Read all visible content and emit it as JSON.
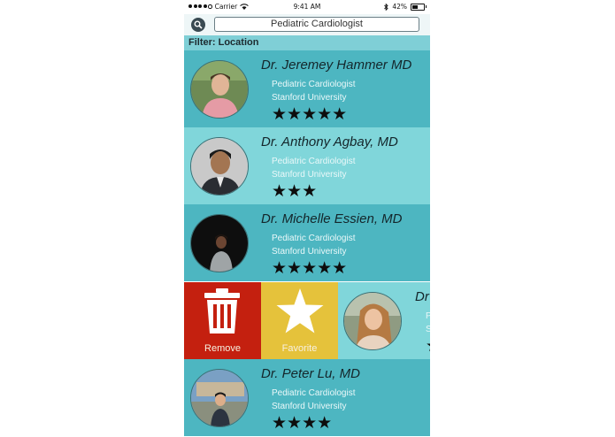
{
  "status_bar": {
    "carrier": "Carrier",
    "time": "9:41 AM",
    "battery": "42%",
    "icons": [
      "signal-dots-icon",
      "wifi-icon",
      "bluetooth-icon",
      "battery-icon"
    ]
  },
  "search": {
    "value": "Pediatric Cardiologist",
    "icon": "search-icon"
  },
  "filter": {
    "label": "Filter: Location"
  },
  "doctors": [
    {
      "name": "Dr. Jeremey Hammer MD",
      "specialty": "Pediatric Cardiologist",
      "institution": "Stanford University",
      "rating": 5,
      "stars": "★★★★★"
    },
    {
      "name": "Dr. Anthony Agbay, MD",
      "specialty": "Pediatric Cardiologist",
      "institution": "Stanford University",
      "rating": 3,
      "stars": "★★★"
    },
    {
      "name": "Dr. Michelle Essien, MD",
      "specialty": "Pediatric Cardiologist",
      "institution": "Stanford University",
      "rating": 5,
      "stars": "★★★★★"
    },
    {
      "name": "Dr",
      "specialty": "P",
      "institution": "S",
      "rating": 1,
      "stars": "★"
    },
    {
      "name": "Dr. Peter Lu, MD",
      "specialty": "Pediatric Cardiologist",
      "institution": "Stanford University",
      "rating": 4,
      "stars": "★★★★"
    }
  ],
  "swipe_actions": {
    "remove": "Remove",
    "favorite": "Favorite"
  },
  "colors": {
    "row_dark": "#4db6c1",
    "row_light": "#80d6da",
    "remove": "#c4200f",
    "favorite": "#e5c23b"
  }
}
